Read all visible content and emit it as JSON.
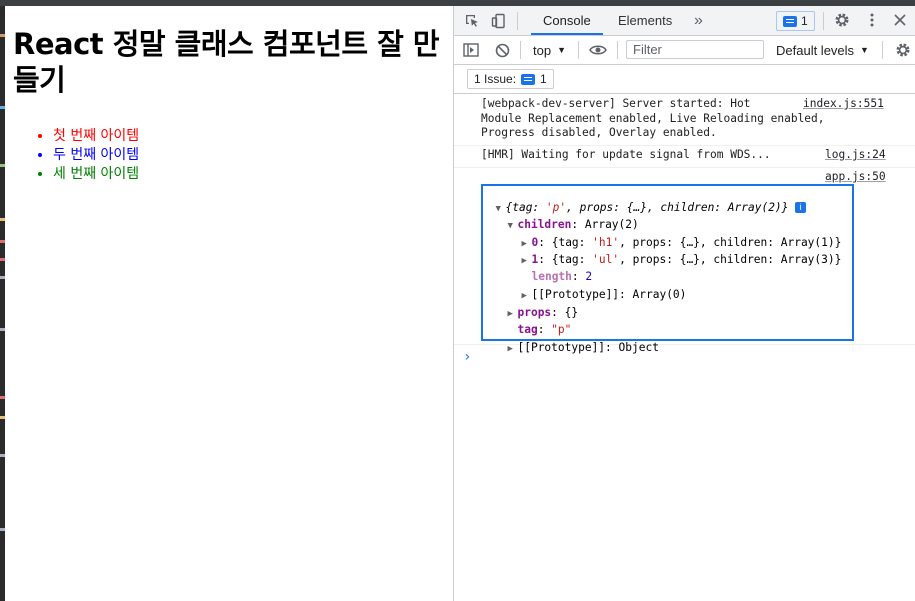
{
  "page": {
    "heading": "React 정말 클래스 컴포넌트 잘 만들기",
    "items": [
      {
        "text": "첫 번째 아이템",
        "color": "#ff0000"
      },
      {
        "text": "두 번째 아이템",
        "color": "#0000ff"
      },
      {
        "text": "세 번째 아이템",
        "color": "#008000"
      }
    ]
  },
  "devtools": {
    "tabs": [
      "Console",
      "Elements"
    ],
    "active_tab": "Console",
    "more_tabs_glyph": "»",
    "issues_count": "1",
    "context": "top",
    "filter_placeholder": "Filter",
    "levels": "Default levels",
    "issue_bar": {
      "label": "1 Issue:",
      "count": "1"
    },
    "logs": [
      {
        "message": "[webpack-dev-server] Server started: Hot\nModule Replacement enabled, Live Reloading enabled,\nProgress disabled, Overlay enabled.",
        "source": "index.js:551"
      },
      {
        "message": "[HMR] Waiting for update signal from WDS...",
        "source": "log.js:24"
      },
      {
        "source": "app.js:50"
      }
    ],
    "object": {
      "summary_open": "{tag: ",
      "summary_tag": "'p'",
      "summary_mid": ", props: {…}, children: Array(2)}",
      "children_key": "children",
      "children_val": "Array(2)",
      "child0_key": "0",
      "child0_pre": "{tag: ",
      "child0_tag": "'h1'",
      "child0_post": ", props: {…}, children: Array(1)}",
      "child1_key": "1",
      "child1_pre": "{tag: ",
      "child1_tag": "'ul'",
      "child1_post": ", props: {…}, children: Array(3)}",
      "length_key": "length",
      "length_val": "2",
      "proto_arr": "[[Prototype]]: Array(0)",
      "props_key": "props",
      "props_val": "{}",
      "tag_key": "tag",
      "tag_val": "\"p\"",
      "proto_obj": "[[Prototype]]: Object"
    },
    "prompt_glyph": "›"
  }
}
